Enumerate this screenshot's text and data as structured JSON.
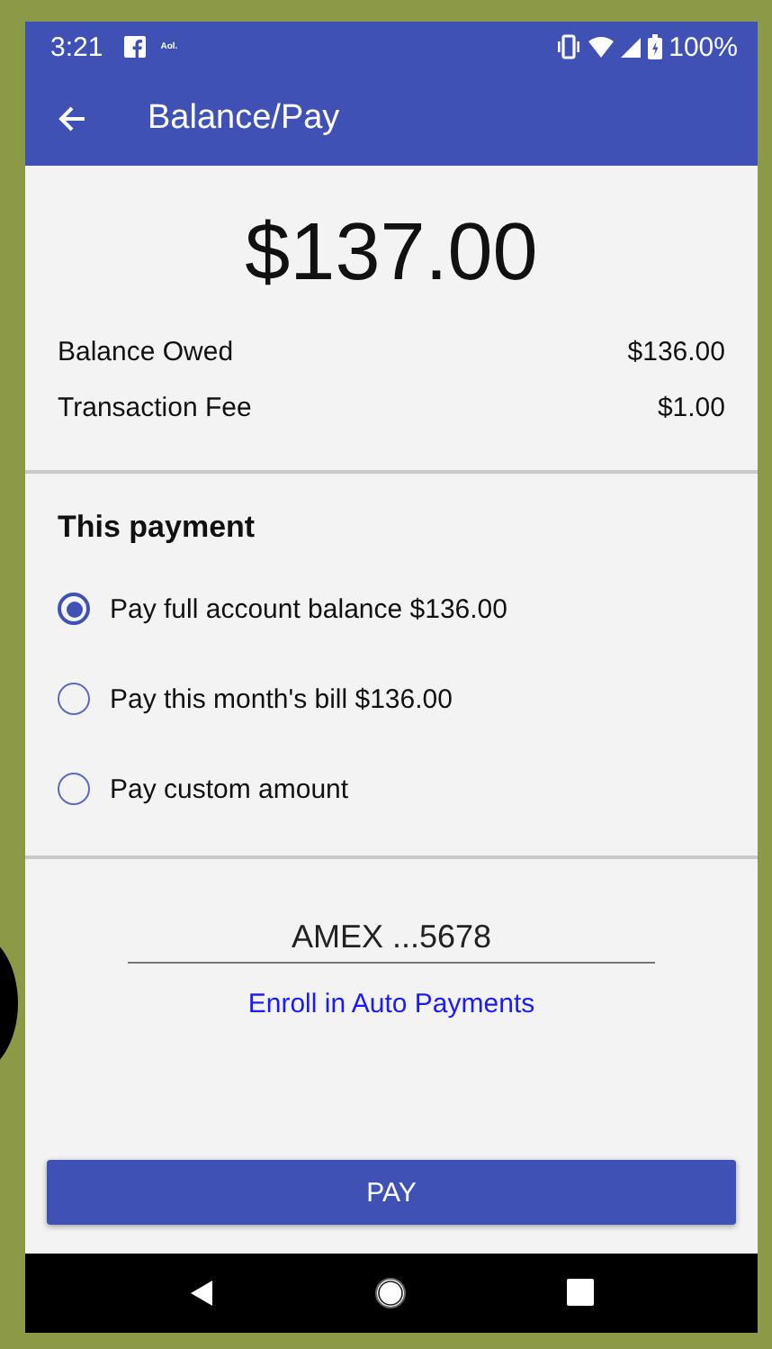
{
  "status_bar": {
    "time": "3:21",
    "notification_text": "Aol.",
    "battery": "100%"
  },
  "app_bar": {
    "title": "Balance/Pay"
  },
  "total": "$137.00",
  "summary": [
    {
      "label": "Balance Owed",
      "value": "$136.00"
    },
    {
      "label": "Transaction Fee",
      "value": "$1.00"
    }
  ],
  "payment": {
    "heading": "This payment",
    "options": [
      {
        "label": "Pay full account balance $136.00",
        "selected": true
      },
      {
        "label": "Pay this month's bill $136.00",
        "selected": false
      },
      {
        "label": "Pay custom amount",
        "selected": false
      }
    ]
  },
  "card": {
    "value": "AMEX ...5678"
  },
  "enroll_link": "Enroll in Auto Payments",
  "pay_button": "PAY"
}
